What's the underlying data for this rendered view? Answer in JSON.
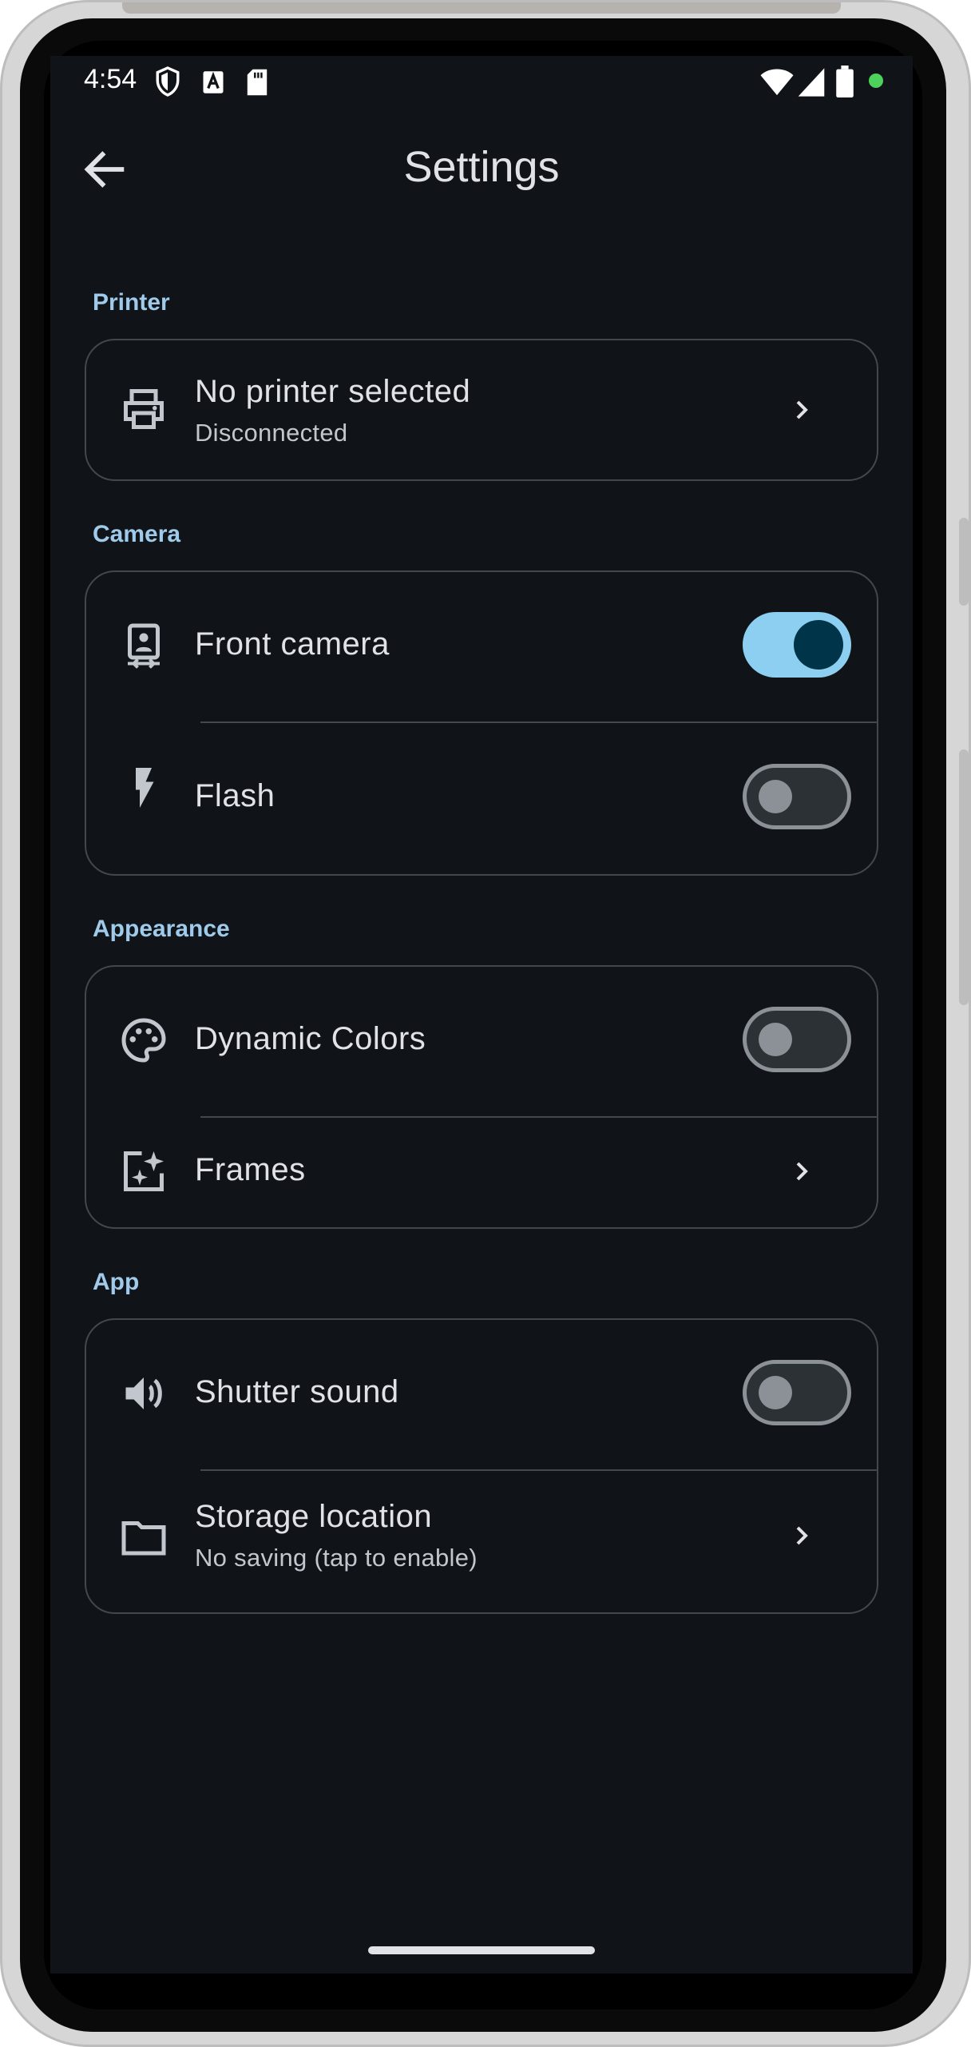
{
  "status_bar": {
    "time": "4:54",
    "icons_left": [
      "shield-icon",
      "a-icon",
      "sd-card-icon"
    ],
    "icons_right": [
      "wifi-icon",
      "signal-icon",
      "battery-icon",
      "dot-icon"
    ]
  },
  "app_bar": {
    "title": "Settings",
    "back_icon": "arrow-back-icon"
  },
  "sections": {
    "printer": {
      "title": "Printer",
      "items": [
        {
          "title": "No printer selected",
          "subtitle": "Disconnected",
          "icon": "printer-icon",
          "control": "chevron"
        }
      ]
    },
    "camera": {
      "title": "Camera",
      "items": [
        {
          "title": "Front camera",
          "icon": "front-camera-icon",
          "control": "toggle",
          "checked": true
        },
        {
          "title": "Flash",
          "icon": "flash-icon",
          "control": "toggle",
          "checked": false
        }
      ]
    },
    "appearance": {
      "title": "Appearance",
      "items": [
        {
          "title": "Dynamic Colors",
          "icon": "palette-icon",
          "control": "toggle",
          "checked": false
        },
        {
          "title": "Frames",
          "icon": "frame-sparkle-icon",
          "control": "chevron"
        }
      ]
    },
    "app": {
      "title": "App",
      "items": [
        {
          "title": "Shutter sound",
          "icon": "volume-icon",
          "control": "toggle",
          "checked": false
        },
        {
          "title": "Storage location",
          "subtitle": "No saving (tap to enable)",
          "icon": "folder-icon",
          "control": "chevron"
        }
      ]
    }
  },
  "colors": {
    "background": "#101419",
    "accent": "#9fcaea",
    "toggle_on_track": "#8ccff0",
    "toggle_on_knob": "#003549",
    "outline": "#43474e",
    "on_surface": "#e1e2e8"
  }
}
